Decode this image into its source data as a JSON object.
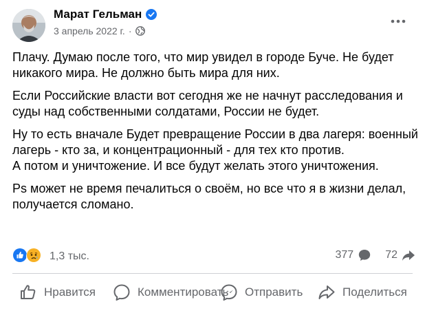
{
  "post": {
    "author": "Марат Гельман",
    "date": "3 апрель 2022 г.",
    "separator": "·",
    "paragraphs": [
      "Плачу. Думаю после того, что мир увидел в городе Буче. Не будет никакого мира. Не должно быть мира для них.",
      "Если Российские власти вот сегодня же не начнут расследования и суды над собственными солдатами,  России не будет.",
      "Ну то есть вначале Будет превращение России в два лагеря: военный лагерь - кто за, и концентрационный - для тех кто против.\nА потом и уничтожение. И все будут желать этого уничтожения.",
      "Ps может не время печалиться о своём, но все что я в жизни делал, получается сломано."
    ]
  },
  "reactions": {
    "count": "1,3 тыс.",
    "comments": "377",
    "shares": "72"
  },
  "actions": {
    "like": "Нравится",
    "comment": "Комментировать",
    "send": "Отправить",
    "share": "Поделиться"
  },
  "colors": {
    "text": "#050505",
    "secondary": "#65676b",
    "verified": "#1877f2",
    "like": "#1877f2",
    "sad": "#f7b125"
  }
}
